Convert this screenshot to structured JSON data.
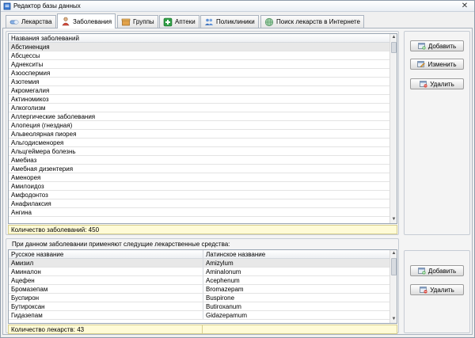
{
  "window": {
    "title": "Редактор базы данных"
  },
  "tabs": [
    {
      "label": "Лекарства",
      "icon": "medicine-icon"
    },
    {
      "label": "Заболевания",
      "icon": "patient-icon"
    },
    {
      "label": "Группы",
      "icon": "box-icon"
    },
    {
      "label": "Аптеки",
      "icon": "pharmacy-icon"
    },
    {
      "label": "Поликлиники",
      "icon": "people-icon"
    },
    {
      "label": "Поиск лекарств в Интернете",
      "icon": "globe-icon"
    }
  ],
  "diseases": {
    "header": "Названия заболеваний",
    "items": [
      "Абстиненция",
      "Абсцессы",
      "Аднекситы",
      "Азооспермия",
      "Азотемия",
      "Акромегалия",
      "Актиномикоз",
      "Алкоголизм",
      "Аллергические заболевания",
      "Алопеция (гнездная)",
      "Альвеолярная пиорея",
      "Альгодисменорея",
      "Альцгеймера болезнь",
      "Амебиаз",
      "Амебная дизентерия",
      "Аменорея",
      "Амилоидоз",
      "Амфодонтоз",
      "Анафилаксия",
      "Ангина"
    ],
    "count_text": "Количество заболеваний: 450"
  },
  "disease_buttons": {
    "add": "Добавить",
    "edit": "Изменить",
    "delete": "Удалить"
  },
  "drugs": {
    "caption": "При данном заболевании применяют следущие лекарственные средства:",
    "col_ru": "Русское название",
    "col_lat": "Латинское название",
    "rows": [
      {
        "ru": "Амизил",
        "lat": "Amizylum"
      },
      {
        "ru": "Аминалон",
        "lat": "Aminalonum"
      },
      {
        "ru": "Ацефен",
        "lat": "Acephenum"
      },
      {
        "ru": "Бромазепам",
        "lat": "Bromazepam"
      },
      {
        "ru": "Буспирон",
        "lat": "Buspirone"
      },
      {
        "ru": "Бутироксан",
        "lat": "Butiroxanum"
      },
      {
        "ru": "Гидазепам",
        "lat": "Gidazepamum"
      }
    ],
    "count_text": "Количество лекарств: 43"
  },
  "drug_buttons": {
    "add": "Добавить",
    "delete": "Удалить"
  }
}
